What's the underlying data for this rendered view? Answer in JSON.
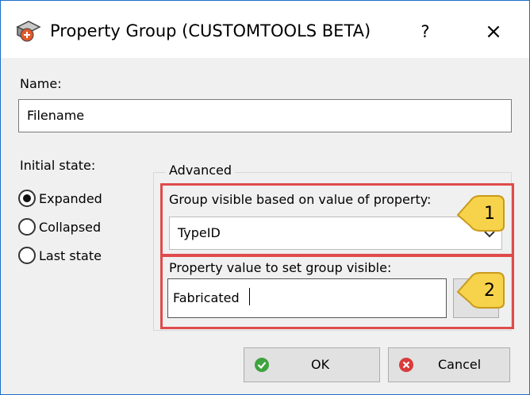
{
  "window": {
    "title": "Property Group (CUSTOMTOOLS BETA)",
    "help_label": "?",
    "close_label": "×"
  },
  "form": {
    "name_label": "Name:",
    "name_value": "Filename",
    "initial_state_label": "Initial state:",
    "initial_state_options": [
      "Expanded",
      "Collapsed",
      "Last state"
    ],
    "initial_state_selected": "Expanded",
    "advanced_label": "Advanced",
    "group_visible_label": "Group visible based on value of property:",
    "group_visible_value": "TypeID",
    "property_value_label": "Property value to set group visible:",
    "property_value_value": "Fabricated"
  },
  "callouts": [
    "1",
    "2"
  ],
  "buttons": {
    "ok_label": "OK",
    "cancel_label": "Cancel"
  },
  "colors": {
    "highlight": "#e04b4b",
    "callout_fill": "#f7d34b",
    "ok_green": "#3fa33f",
    "cancel_red": "#d93b3b",
    "window_border": "#1c6fc6"
  }
}
